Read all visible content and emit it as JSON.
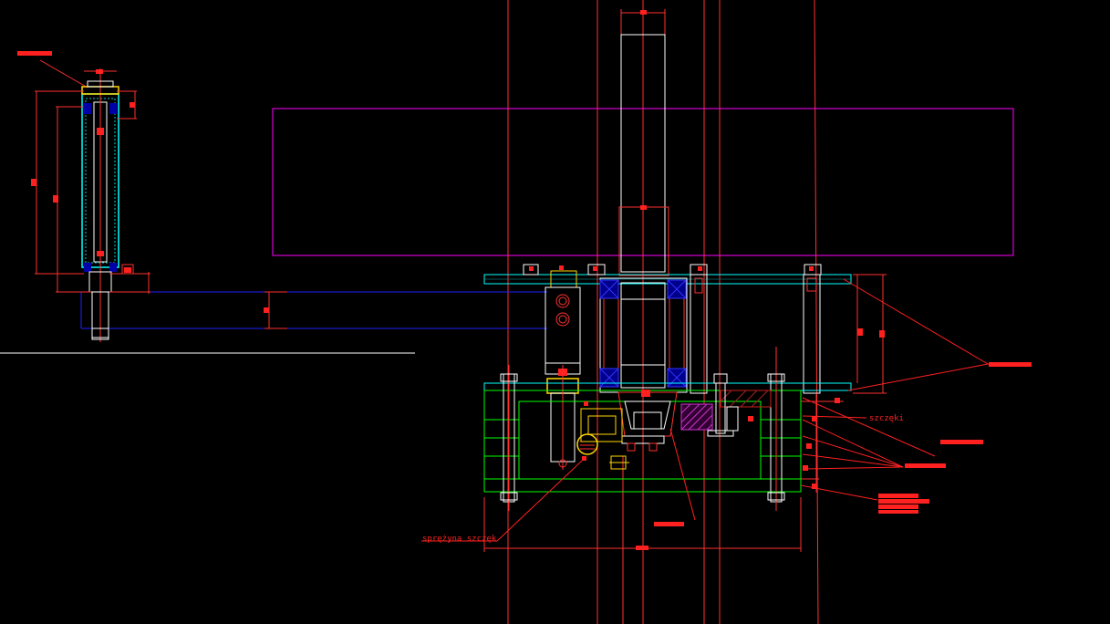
{
  "drawing": {
    "background_color": "#000000",
    "layer_colors": {
      "axis": "#ff3030",
      "outline": "#ffffff",
      "frame": "#ff00ff",
      "beam": "#0000ff",
      "plate": "#00ffff",
      "base": "#00ff00",
      "gold": "#ffd700",
      "hatch": "#cc33cc",
      "seal": "#0000aa",
      "leader": "#ff2020"
    },
    "annotations": {
      "springs_label": "sprężyna szczęk",
      "jaws_label": "szczęki"
    }
  }
}
